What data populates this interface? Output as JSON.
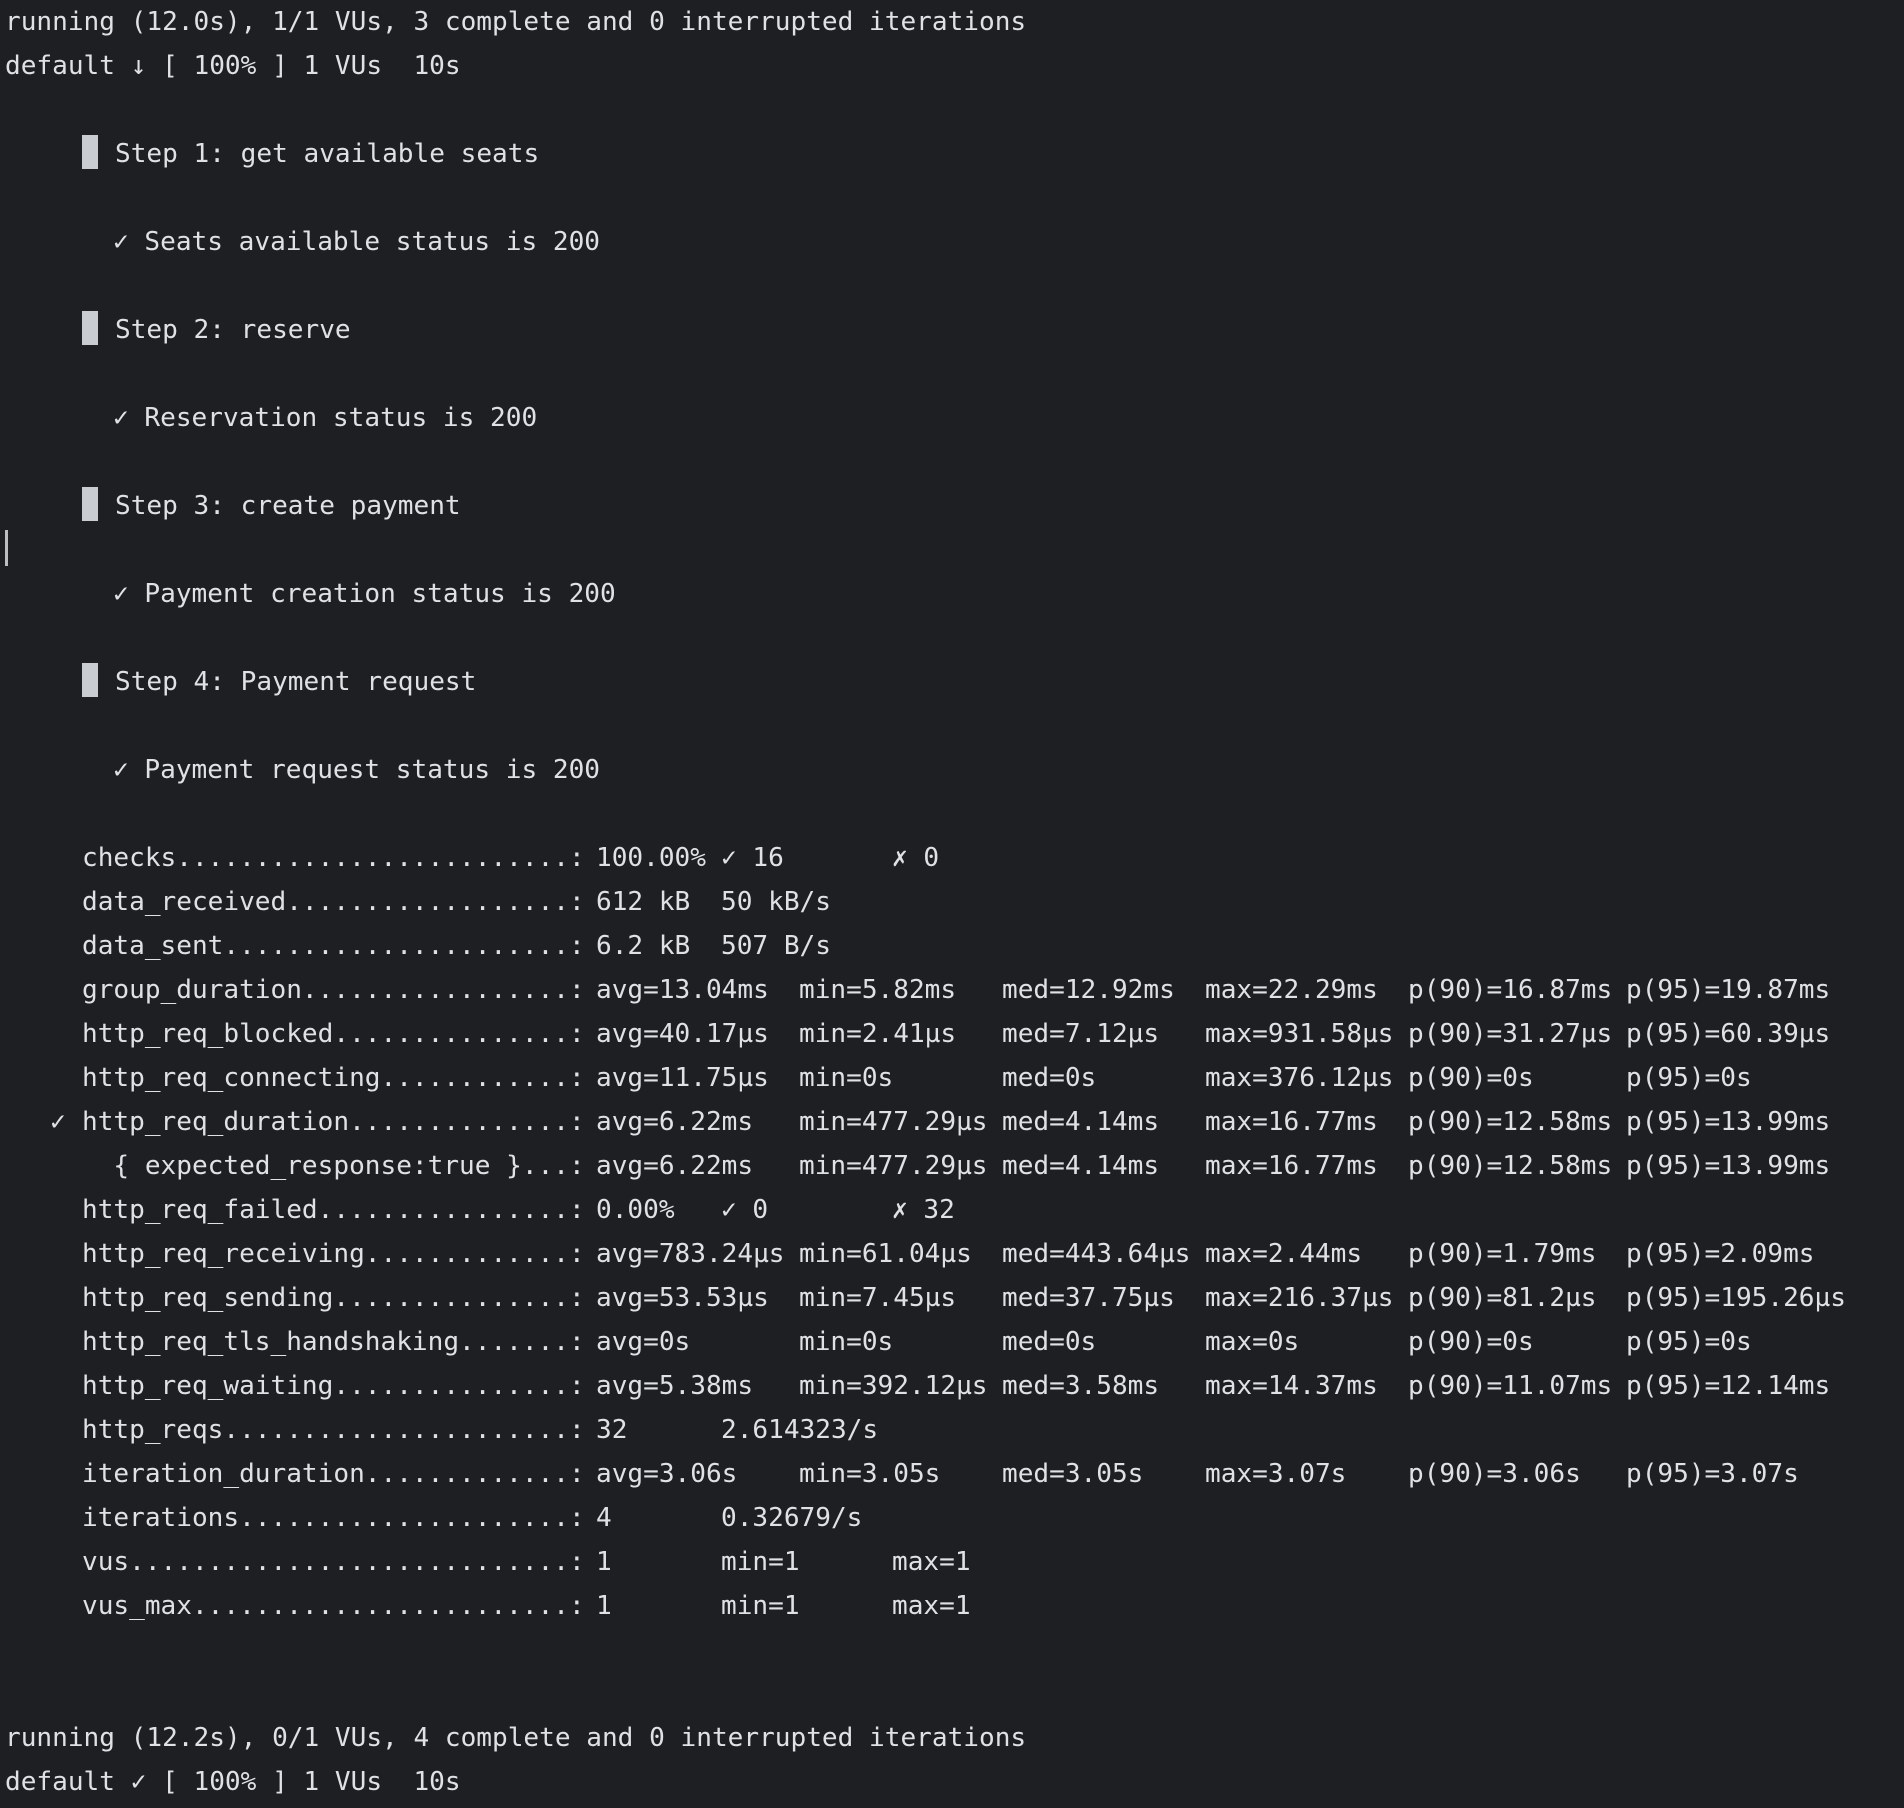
{
  "header": {
    "status_line": "running (12.0s), 1/1 VUs, 3 complete and 0 interrupted iterations",
    "progress_line": "default ↓ [ 100% ] 1 VUs  10s"
  },
  "steps": [
    {
      "title": "Step 1: get available seats",
      "check": "✓ Seats available status is 200"
    },
    {
      "title": "Step 2: reserve",
      "check": "✓ Reservation status is 200"
    },
    {
      "title": "Step 3: create payment",
      "check": "✓ Payment creation status is 200"
    },
    {
      "title": "Step 4: Payment request",
      "check": "✓ Payment request status is 200"
    }
  ],
  "metrics": [
    {
      "mark": "",
      "name": "checks.........................:",
      "cols": [
        "100.00%",
        "✓ 16",
        "",
        "✗ 0",
        "",
        ""
      ],
      "layout": "checks"
    },
    {
      "mark": "",
      "name": "data_received..................:",
      "cols": [
        "612 kB",
        "50 kB/s"
      ],
      "layout": "pair"
    },
    {
      "mark": "",
      "name": "data_sent......................:",
      "cols": [
        "6.2 kB",
        "507 B/s"
      ],
      "layout": "pair"
    },
    {
      "mark": "",
      "name": "group_duration.................:",
      "cols": [
        "avg=13.04ms",
        "min=5.82ms",
        "med=12.92ms",
        "max=22.29ms",
        "p(90)=16.87ms",
        "p(95)=19.87ms"
      ],
      "layout": "stats"
    },
    {
      "mark": "",
      "name": "http_req_blocked...............:",
      "cols": [
        "avg=40.17µs",
        "min=2.41µs",
        "med=7.12µs",
        "max=931.58µs",
        "p(90)=31.27µs",
        "p(95)=60.39µs"
      ],
      "layout": "stats"
    },
    {
      "mark": "",
      "name": "http_req_connecting............:",
      "cols": [
        "avg=11.75µs",
        "min=0s",
        "med=0s",
        "max=376.12µs",
        "p(90)=0s",
        "p(95)=0s"
      ],
      "layout": "stats"
    },
    {
      "mark": "✓",
      "name": "http_req_duration..............:",
      "cols": [
        "avg=6.22ms",
        "min=477.29µs",
        "med=4.14ms",
        "max=16.77ms",
        "p(90)=12.58ms",
        "p(95)=13.99ms"
      ],
      "layout": "stats"
    },
    {
      "mark": "",
      "name": "  { expected_response:true }...:",
      "cols": [
        "avg=6.22ms",
        "min=477.29µs",
        "med=4.14ms",
        "max=16.77ms",
        "p(90)=12.58ms",
        "p(95)=13.99ms"
      ],
      "layout": "stats"
    },
    {
      "mark": "",
      "name": "http_req_failed................:",
      "cols": [
        "0.00%",
        "✓ 0",
        "",
        "✗ 32",
        "",
        ""
      ],
      "layout": "checks"
    },
    {
      "mark": "",
      "name": "http_req_receiving.............:",
      "cols": [
        "avg=783.24µs",
        "min=61.04µs",
        "med=443.64µs",
        "max=2.44ms",
        "p(90)=1.79ms",
        "p(95)=2.09ms"
      ],
      "layout": "stats"
    },
    {
      "mark": "",
      "name": "http_req_sending...............:",
      "cols": [
        "avg=53.53µs",
        "min=7.45µs",
        "med=37.75µs",
        "max=216.37µs",
        "p(90)=81.2µs",
        "p(95)=195.26µs"
      ],
      "layout": "stats"
    },
    {
      "mark": "",
      "name": "http_req_tls_handshaking.......:",
      "cols": [
        "avg=0s",
        "min=0s",
        "med=0s",
        "max=0s",
        "p(90)=0s",
        "p(95)=0s"
      ],
      "layout": "stats"
    },
    {
      "mark": "",
      "name": "http_req_waiting...............:",
      "cols": [
        "avg=5.38ms",
        "min=392.12µs",
        "med=3.58ms",
        "max=14.37ms",
        "p(90)=11.07ms",
        "p(95)=12.14ms"
      ],
      "layout": "stats"
    },
    {
      "mark": "",
      "name": "http_reqs......................:",
      "cols": [
        "32",
        "2.614323/s"
      ],
      "layout": "pair"
    },
    {
      "mark": "",
      "name": "iteration_duration.............:",
      "cols": [
        "avg=3.06s",
        "min=3.05s",
        "med=3.05s",
        "max=3.07s",
        "p(90)=3.06s",
        "p(95)=3.07s"
      ],
      "layout": "stats"
    },
    {
      "mark": "",
      "name": "iterations.....................:",
      "cols": [
        "4",
        "0.32679/s"
      ],
      "layout": "pair"
    },
    {
      "mark": "",
      "name": "vus............................:",
      "cols": [
        "1",
        "min=1",
        "max=1"
      ],
      "layout": "vus"
    },
    {
      "mark": "",
      "name": "vus_max........................:",
      "cols": [
        "1",
        "min=1",
        "max=1"
      ],
      "layout": "vus"
    }
  ],
  "footer": {
    "status_line": "running (12.2s), 0/1 VUs, 4 complete and 0 interrupted iterations",
    "progress_line": "default ✓ [ 100% ] 1 VUs  10s"
  },
  "colors": {
    "background": "#1e1f22",
    "foreground": "#dfe1e5",
    "step_marker": "#c9ccd1"
  }
}
